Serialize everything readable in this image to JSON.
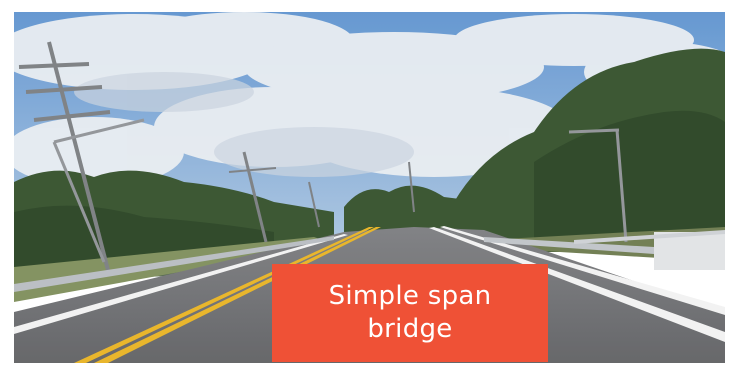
{
  "caption": {
    "text": "Simple span bridge",
    "background_color": "#EF5136",
    "text_color": "#FFFFFF"
  },
  "photo": {
    "sky_color": "#7FA8D6",
    "cloud_color": "#E8ECF1",
    "tree_color": "#2F4A25",
    "road_color": "#6E6F71",
    "center_line_color": "#E8B321",
    "edge_line_color": "#F2F2F2"
  }
}
